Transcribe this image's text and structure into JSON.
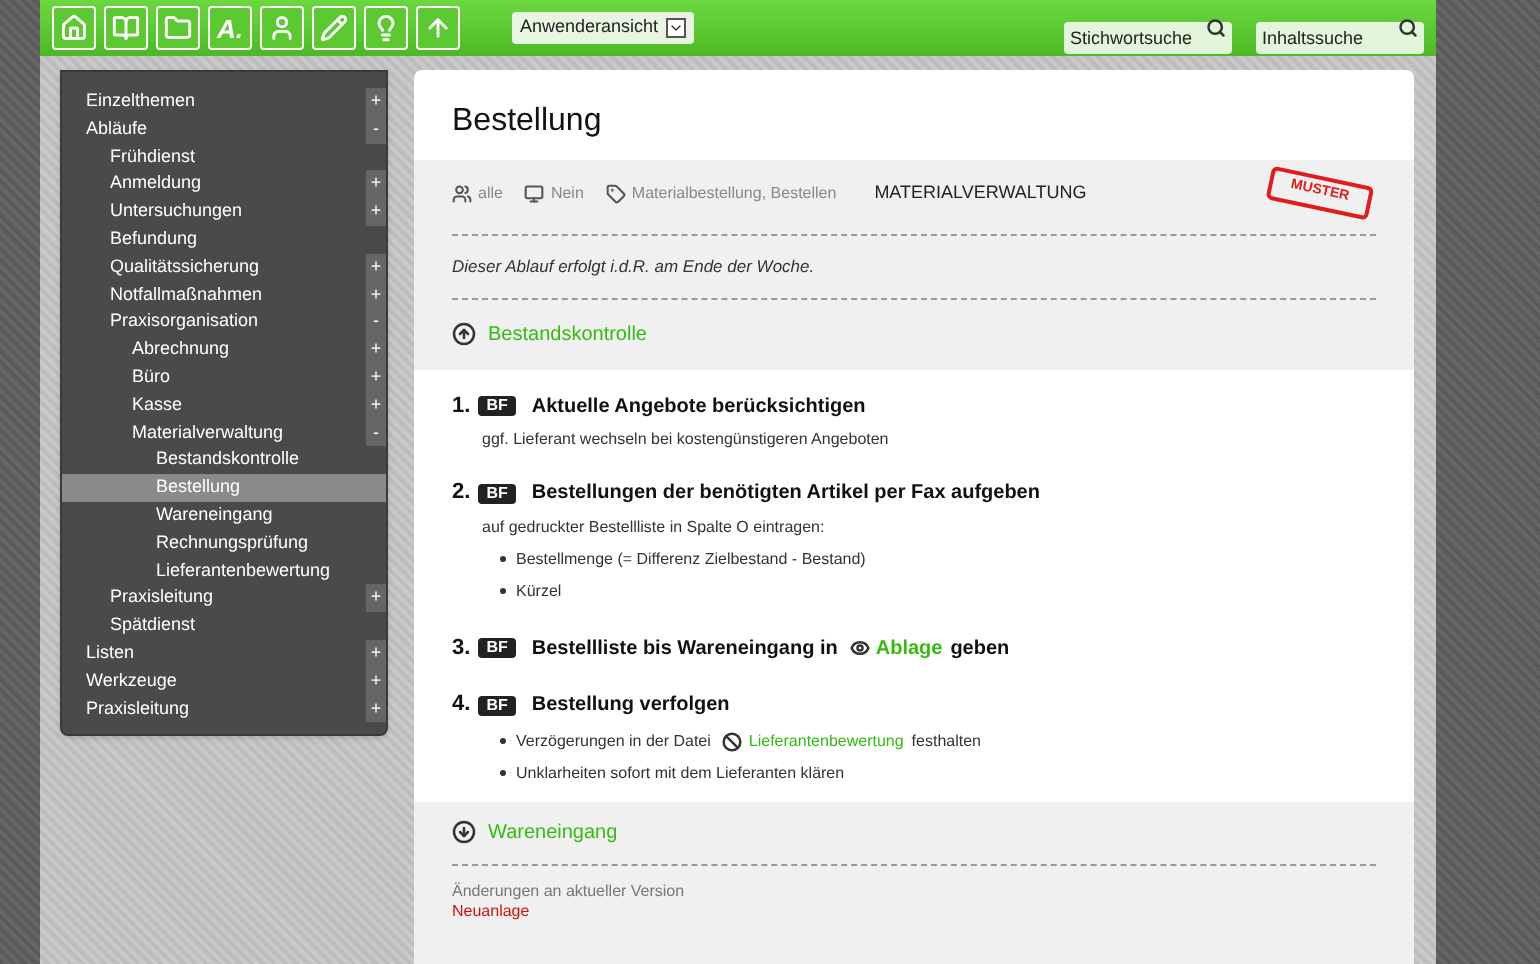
{
  "toolbar": {
    "buttons": [
      {
        "kind": "home"
      },
      {
        "kind": "book"
      },
      {
        "kind": "folder"
      },
      {
        "kind": "text",
        "label": "A."
      },
      {
        "kind": "person"
      },
      {
        "kind": "pencil"
      },
      {
        "kind": "bulb"
      },
      {
        "kind": "up"
      }
    ],
    "view_select": {
      "value": "Anwenderansicht"
    },
    "searches": [
      {
        "placeholder": "Stichwortsuche"
      },
      {
        "placeholder": "Inhaltssuche"
      }
    ]
  },
  "sidebar": {
    "items": [
      {
        "label": "Einzelthemen",
        "toggle": "+",
        "selected": false
      },
      {
        "label": "Abläufe",
        "toggle": "-",
        "selected": false,
        "children": [
          {
            "label": "Frühdienst",
            "selected": false
          },
          {
            "label": "Anmeldung",
            "toggle": "+",
            "selected": false
          },
          {
            "label": "Untersuchungen",
            "toggle": "+",
            "selected": false
          },
          {
            "label": "Befundung",
            "selected": false
          },
          {
            "label": "Qualitätssicherung",
            "toggle": "+",
            "selected": false
          },
          {
            "label": "Notfallmaßnahmen",
            "toggle": "+",
            "selected": false
          },
          {
            "label": "Praxisorganisation",
            "toggle": "-",
            "selected": false,
            "children": [
              {
                "label": "Abrechnung",
                "toggle": "+",
                "selected": false
              },
              {
                "label": "Büro",
                "toggle": "+",
                "selected": false
              },
              {
                "label": "Kasse",
                "toggle": "+",
                "selected": false
              },
              {
                "label": "Materialverwaltung",
                "toggle": "-",
                "selected": false,
                "children": [
                  {
                    "label": "Bestandskontrolle",
                    "selected": false
                  },
                  {
                    "label": "Bestellung",
                    "selected": true
                  },
                  {
                    "label": "Wareneingang",
                    "selected": false
                  },
                  {
                    "label": "Rechnungsprüfung",
                    "selected": false
                  },
                  {
                    "label": "Lieferantenbewertung",
                    "selected": false
                  }
                ]
              }
            ]
          },
          {
            "label": "Praxisleitung",
            "toggle": "+",
            "selected": false
          },
          {
            "label": "Spätdienst",
            "selected": false
          }
        ]
      },
      {
        "label": "Listen",
        "toggle": "+",
        "selected": false
      },
      {
        "label": "Werkzeuge",
        "toggle": "+",
        "selected": false
      },
      {
        "label": "Praxisleitung",
        "toggle": "+",
        "selected": false
      }
    ]
  },
  "page": {
    "title": "Bestellung",
    "meta": [
      {
        "kind": "group",
        "text": "alle"
      },
      {
        "kind": "device",
        "text": "Nein"
      },
      {
        "kind": "tag",
        "text": "Materialbestellung, Bestellen"
      },
      {
        "kind": "category",
        "text": "MATERIALVERWALTUNG"
      }
    ],
    "stamp": "MUSTER",
    "note": "Dieser Ablauf erfolgt *i.d.R.* am Ende der Woche.",
    "previous": {
      "label": "Bestandskontrolle"
    },
    "steps": [
      {
        "number": "1.",
        "badge": "BF",
        "title": [
          {
            "kind": "text",
            "text": "Aktuelle Angebote berücksichtigen"
          }
        ],
        "text": "ggf. Lieferant wechseln bei kostengünstigeren Angeboten"
      },
      {
        "number": "2.",
        "badge": "BF",
        "title": [
          {
            "kind": "text",
            "text": "Bestellungen der benötigten Artikel per Fax aufgeben"
          }
        ],
        "text": "auf gedruckter Bestellliste in Spalte O eintragen:",
        "bullets": [
          [
            {
              "kind": "text",
              "text": "Bestellmenge (= Differenz Zielbestand - Bestand)"
            }
          ],
          [
            {
              "kind": "text",
              "text": "Kürzel"
            }
          ]
        ]
      },
      {
        "number": "3.",
        "badge": "BF",
        "title": [
          {
            "kind": "text",
            "text": "Bestellliste bis Wareneingang in"
          },
          {
            "kind": "view-link",
            "text": "Ablage"
          },
          {
            "kind": "text",
            "text": "geben"
          }
        ]
      },
      {
        "number": "4.",
        "badge": "BF",
        "title": [
          {
            "kind": "text",
            "text": "Bestellung verfolgen"
          }
        ],
        "bullets": [
          [
            {
              "kind": "text",
              "text": "Verzögerungen in der Datei"
            },
            {
              "kind": "file-link",
              "text": "Lieferantenbewertung"
            },
            {
              "kind": "text",
              "text": "festhalten"
            }
          ],
          [
            {
              "kind": "text",
              "text": "Unklarheiten sofort mit dem Lieferanten klären"
            }
          ]
        ]
      }
    ],
    "next": {
      "label": "Wareneingang"
    },
    "changes": {
      "heading": "Änderungen an aktueller Version",
      "entry": "Neuanlage"
    }
  }
}
